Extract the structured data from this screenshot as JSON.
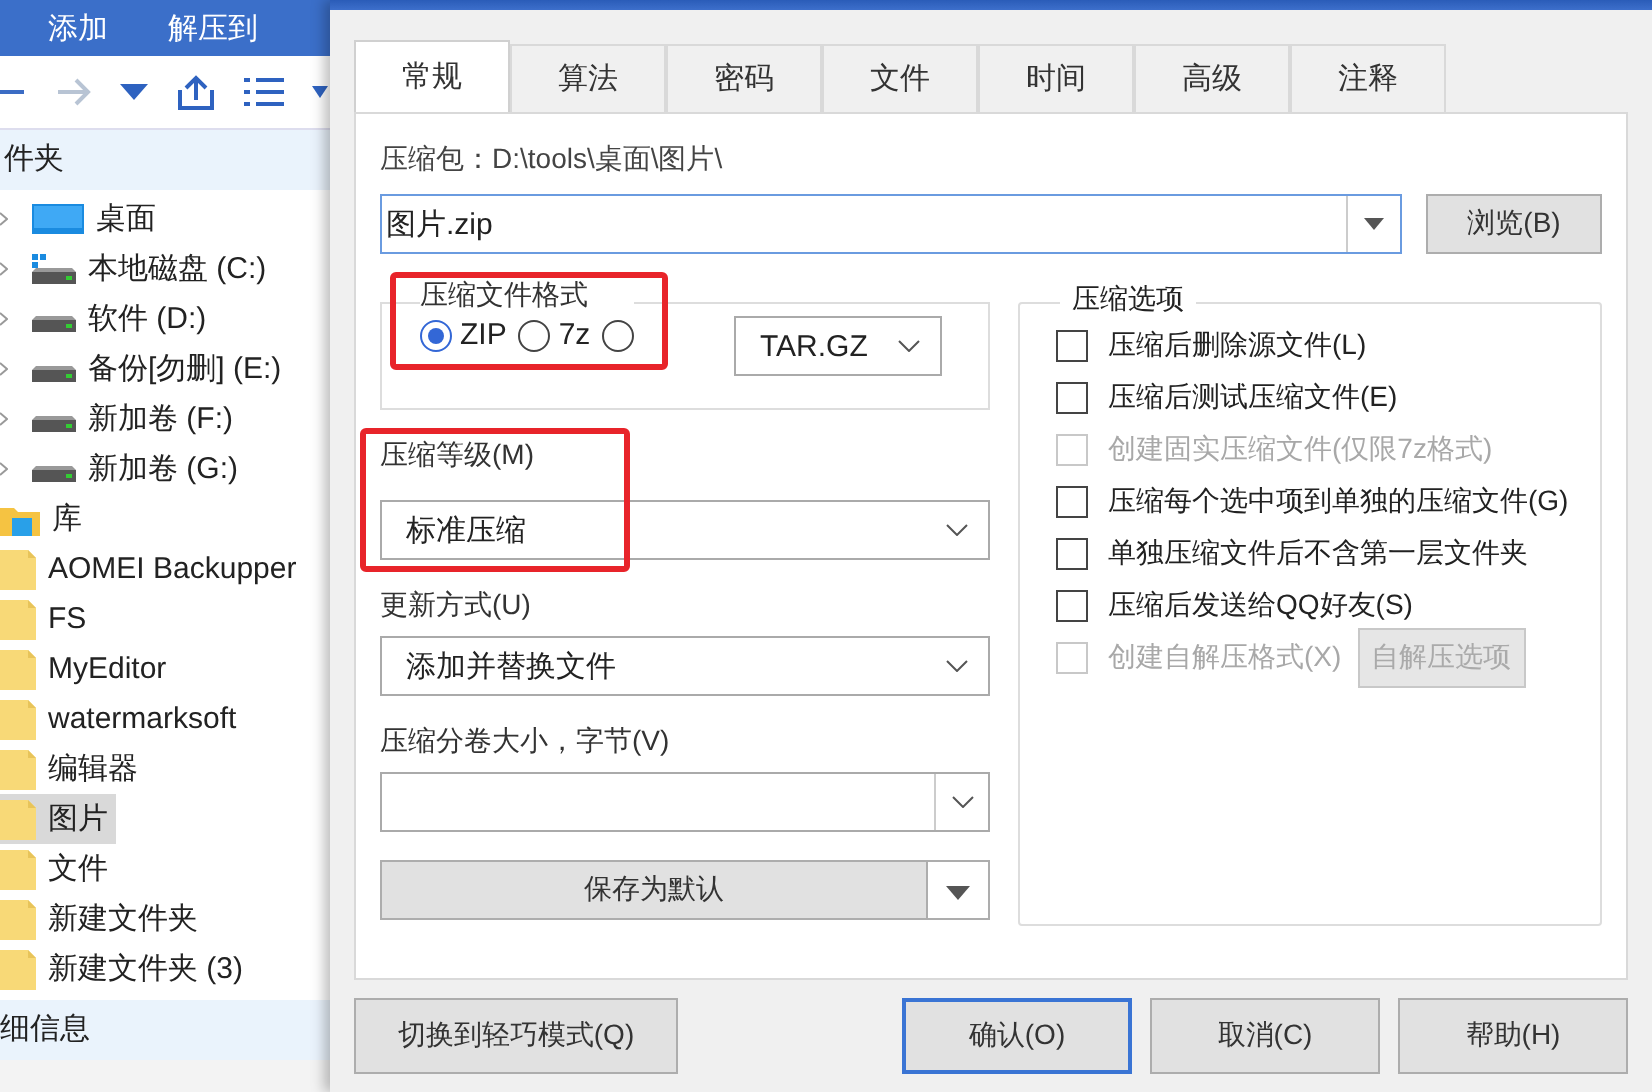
{
  "toolbar": {
    "buttons": [
      {
        "label": "添加"
      },
      {
        "label": "解压到"
      }
    ]
  },
  "explorer": {
    "header": "件夹",
    "items": [
      {
        "label": "桌面",
        "kind": "desktop",
        "selected": false
      },
      {
        "label": "本地磁盘 (C:)",
        "kind": "system_drive",
        "selected": false
      },
      {
        "label": "软件 (D:)",
        "kind": "drive",
        "selected": false
      },
      {
        "label": "备份[勿删] (E:)",
        "kind": "drive",
        "selected": false
      },
      {
        "label": "新加卷 (F:)",
        "kind": "drive",
        "selected": false
      },
      {
        "label": "新加卷 (G:)",
        "kind": "drive",
        "selected": false
      },
      {
        "label": "库",
        "kind": "library",
        "selected": false
      },
      {
        "label": "AOMEI Backupper",
        "kind": "folder",
        "selected": false
      },
      {
        "label": "FS",
        "kind": "folder",
        "selected": false
      },
      {
        "label": "MyEditor",
        "kind": "folder",
        "selected": false
      },
      {
        "label": "watermarksoft",
        "kind": "folder",
        "selected": false
      },
      {
        "label": "编辑器",
        "kind": "folder",
        "selected": false
      },
      {
        "label": "图片",
        "kind": "folder",
        "selected": true
      },
      {
        "label": "文件",
        "kind": "folder",
        "selected": false
      },
      {
        "label": "新建文件夹",
        "kind": "folder",
        "selected": false
      },
      {
        "label": "新建文件夹 (3)",
        "kind": "folder",
        "selected": false
      }
    ],
    "details": "细信息"
  },
  "dialog": {
    "tabs": [
      {
        "label": "常规",
        "selected": true
      },
      {
        "label": "算法",
        "selected": false
      },
      {
        "label": "密码",
        "selected": false
      },
      {
        "label": "文件",
        "selected": false
      },
      {
        "label": "时间",
        "selected": false
      },
      {
        "label": "高级",
        "selected": false
      },
      {
        "label": "注释",
        "selected": false
      }
    ],
    "path_label": "压缩包：D:\\tools\\桌面\\图片\\",
    "filename": "图片.zip",
    "browse_button": "浏览(B)",
    "format": {
      "legend": "压缩文件格式",
      "highlighted": true,
      "options": [
        {
          "label": "ZIP",
          "selected": true
        },
        {
          "label": "7z",
          "selected": false
        },
        {
          "selected": false
        }
      ],
      "other_format": "TAR.GZ"
    },
    "level": {
      "label": "压缩等级(M)",
      "value": "标准压缩",
      "highlighted": true
    },
    "update": {
      "label": "更新方式(U)",
      "value": "添加并替换文件"
    },
    "split": {
      "label": "压缩分卷大小，字节(V)"
    },
    "save_default": "保存为默认",
    "options": {
      "legend": "压缩选项",
      "items": [
        {
          "label": "压缩后删除源文件(L)",
          "checked": false,
          "disabled": false
        },
        {
          "label": "压缩后测试压缩文件(E)",
          "checked": false,
          "disabled": false
        },
        {
          "label": "创建固实压缩文件(仅限7z格式)",
          "checked": false,
          "disabled": true
        },
        {
          "label": "压缩每个选中项到单独的压缩文件(G)",
          "checked": false,
          "disabled": false
        },
        {
          "label": "单独压缩文件后不含第一层文件夹",
          "checked": false,
          "disabled": false
        },
        {
          "label": "压缩后发送给QQ好友(S)",
          "checked": false,
          "disabled": false
        },
        {
          "label": "创建自解压格式(X)",
          "checked": false,
          "disabled": true
        }
      ],
      "sfx_button": {
        "label": "自解压选项",
        "disabled": true
      }
    },
    "mode_button": "切换到轻巧模式(Q)",
    "buttons": [
      {
        "label": "确认(O)",
        "default": true
      },
      {
        "label": "取消(C)",
        "default": false
      },
      {
        "label": "帮助(H)",
        "default": false
      }
    ]
  }
}
